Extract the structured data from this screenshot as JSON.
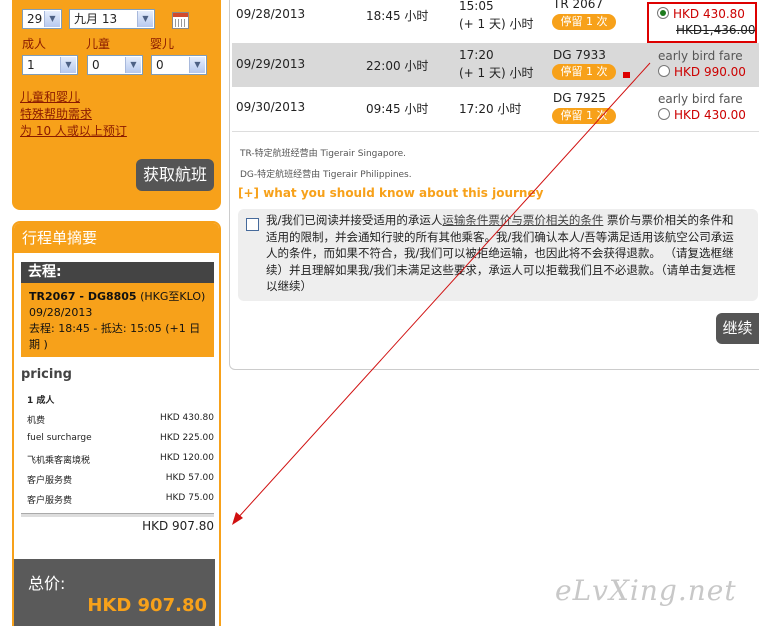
{
  "search": {
    "day": "29",
    "month": "九月 13",
    "labels": {
      "adult": "成人",
      "child": "儿童",
      "infant": "婴儿"
    },
    "adult_count": "1",
    "child_count": "0",
    "infant_count": "0",
    "links": [
      "儿童和婴儿",
      "特殊帮助需求",
      "为 10 人或以上预订"
    ],
    "search_button": "获取航班"
  },
  "summary": {
    "title": "行程单摘要",
    "outbound_label": "去程:",
    "flight_line_bold": "TR2067 - DG8805",
    "flight_route": " (HKG至KLO)",
    "date": "09/28/2013",
    "times": "去程:  18:45 - 抵达:  15:05 (+1 日期 )",
    "pricing_title": "pricing",
    "pax": "1  成人",
    "rows": [
      {
        "label": "机费",
        "value": "HKD 430.80"
      },
      {
        "label": "fuel surcharge",
        "value": "HKD 225.00"
      },
      {
        "label": "飞机乘客离境税",
        "value": "HKD 120.00"
      },
      {
        "label": "客户服务费",
        "value": "HKD 57.00"
      },
      {
        "label": "客户服务费",
        "value": "HKD 75.00"
      }
    ],
    "subtotal": "HKD 907.80",
    "total_label": "总价:",
    "total_value": "HKD  907.80"
  },
  "flights": [
    {
      "date": "09/28/2013",
      "duration": "18:45 小时",
      "arr_time": "15:05",
      "arr_offset": "(+ 1 天) 小时",
      "flight": "TR 2067",
      "stops": "停留 1 次",
      "fare_label": "",
      "price": "HKD 430.80",
      "old_price": "HKD1,436.00",
      "selected": true
    },
    {
      "date": "09/29/2013",
      "duration": "22:00 小时",
      "arr_time": "17:20",
      "arr_offset": "(+ 1 天) 小时",
      "flight": "DG 7933",
      "stops": "停留 1 次",
      "fare_label": "early bird fare",
      "price": "HKD 990.00",
      "old_price": "",
      "selected": false
    },
    {
      "date": "09/30/2013",
      "duration": "09:45 小时",
      "arr_time": "17:20 小时",
      "arr_offset": "",
      "flight": "DG 7925",
      "stops": "停留 1 次",
      "fare_label": "early bird fare",
      "price": "HKD 430.00",
      "old_price": "",
      "selected": false
    }
  ],
  "notes": {
    "tr": "TR-特定航班经营由 Tigerair Singapore.",
    "dg": "DG-特定航班经营由 Tigerair Philippines.",
    "know_link": "[+] what you should know about this journey"
  },
  "terms": {
    "prefix": "我/我们已阅读并接受适用的承运人",
    "link1": "运输条件",
    "link2": "票价与票价相关的条件",
    "suffix": " 票价与票价相关的条件和适用的限制，并会通知行驶的所有其他乘客。我/我们确认本人/吾等满足适用该航空公司承运人的条件，而如果不符合，我/我们可以被拒绝运输，也因此将不会获得退款。 （请复选框继续）并且理解如果我/我们未满足这些要求，承运人可以拒载我们且不必退款。（请单击复选框以继续）"
  },
  "continue_button": "继续",
  "watermark": "eLvXing.net",
  "colors": {
    "accent": "#f7a11a",
    "price": "#cc0000",
    "dark": "#555555",
    "highlight": "#dd0000"
  }
}
